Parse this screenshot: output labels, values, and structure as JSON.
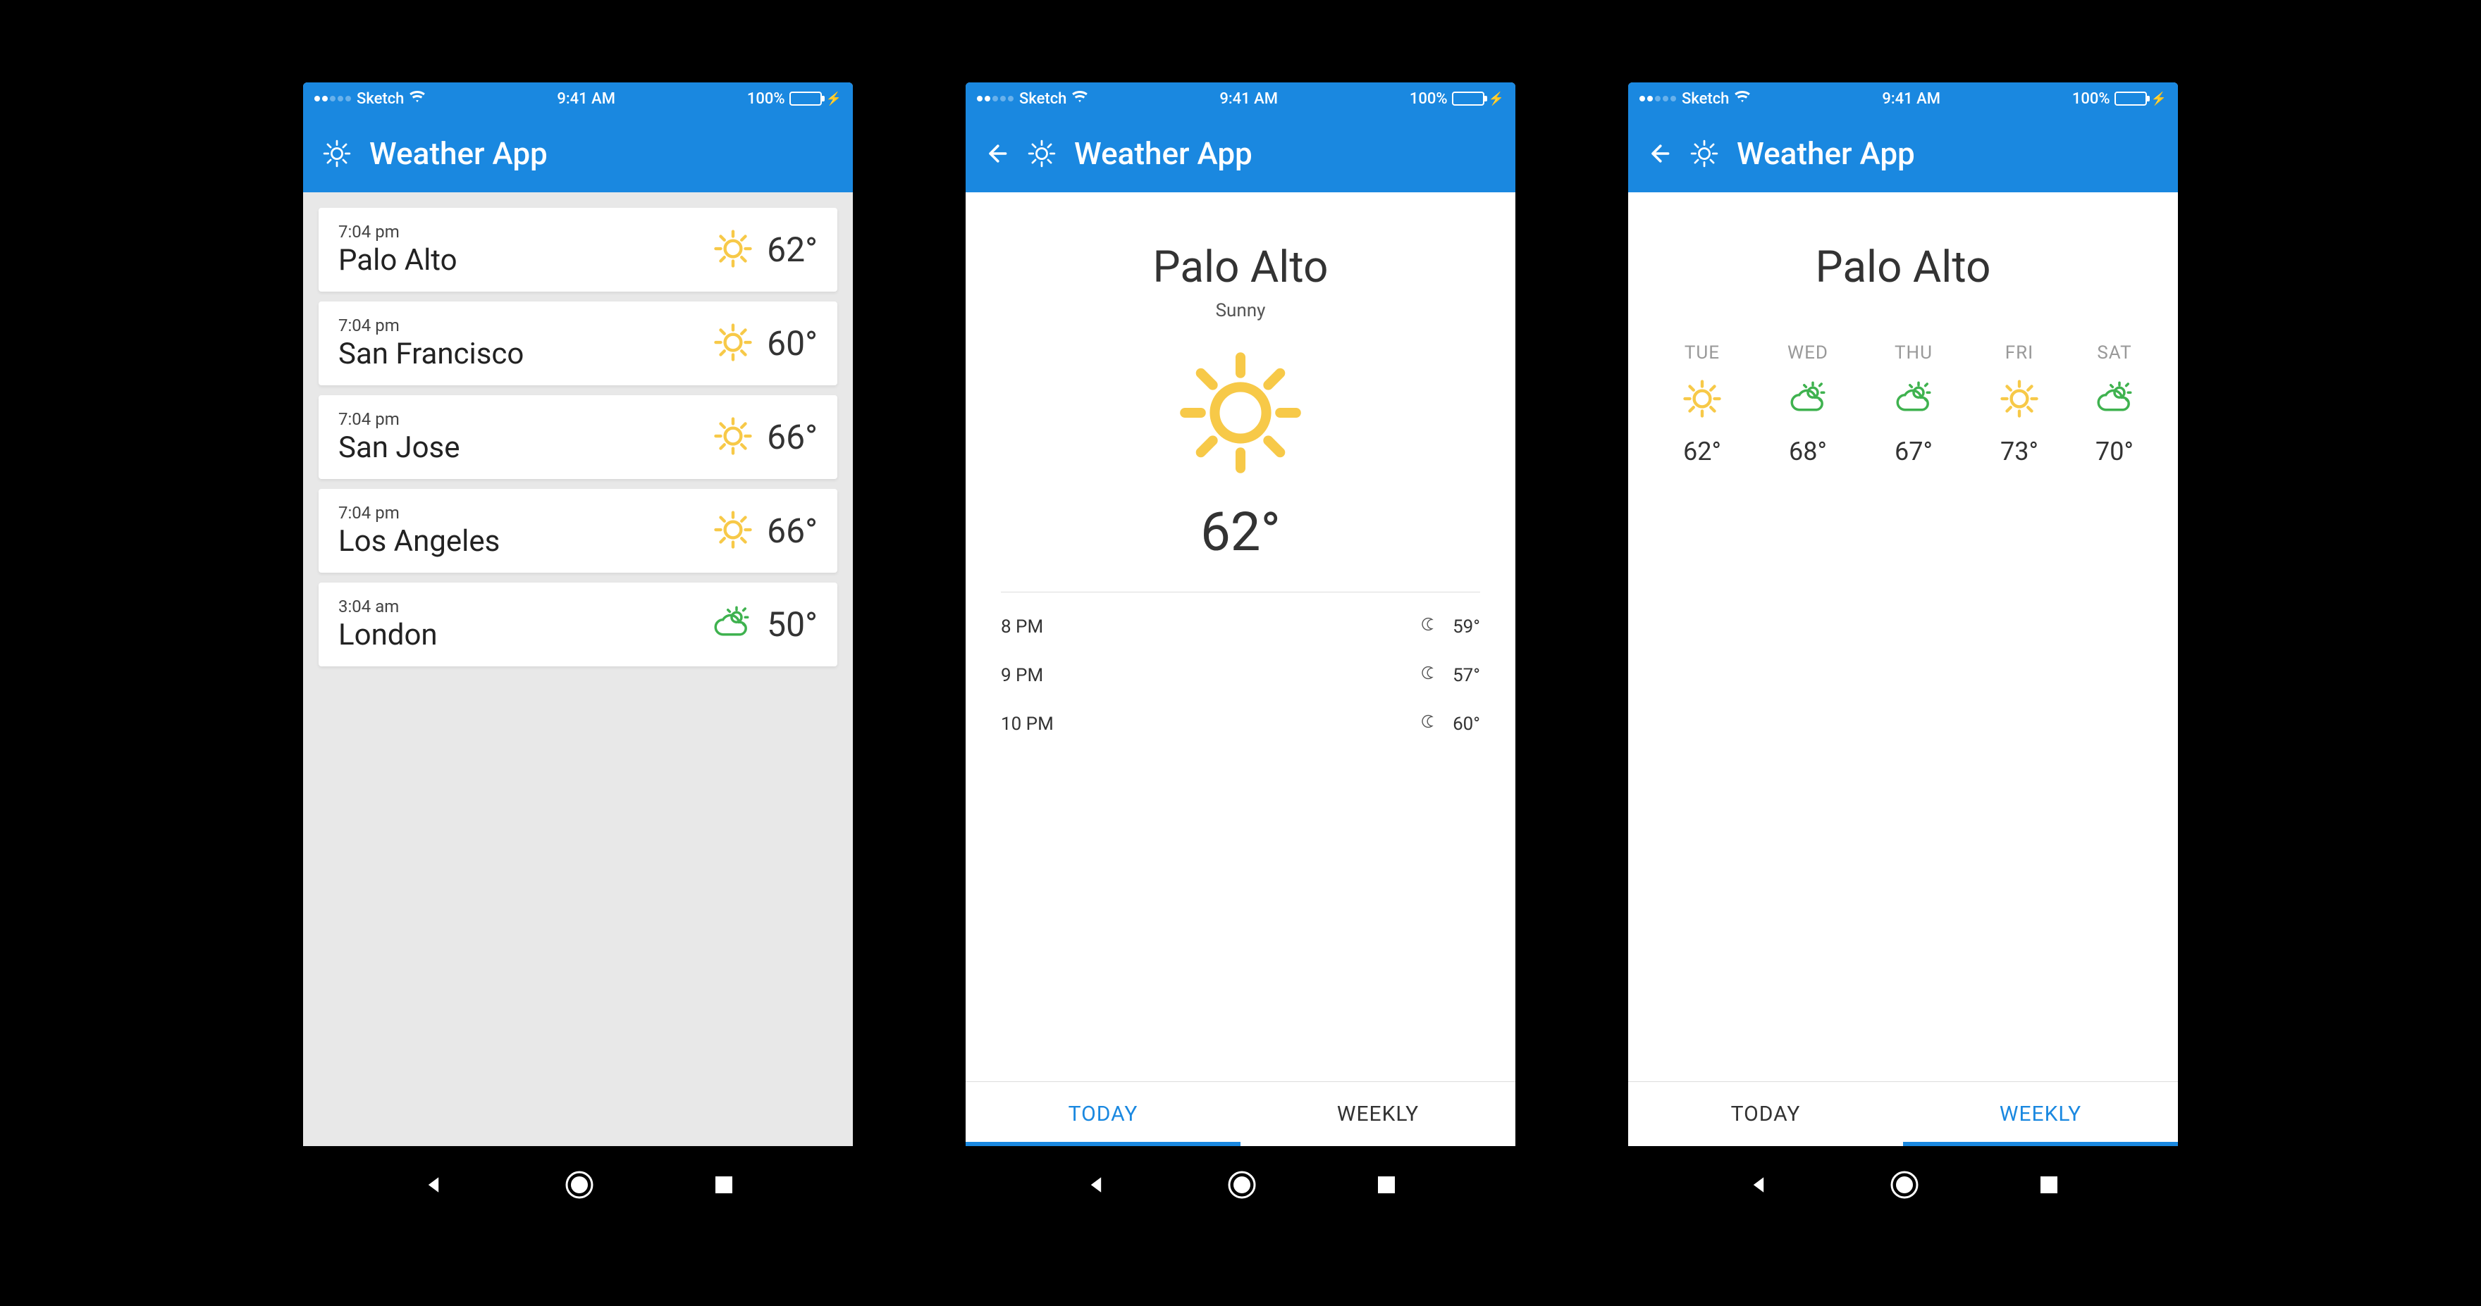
{
  "status": {
    "carrier": "Sketch",
    "time": "9:41 AM",
    "battery": "100%"
  },
  "app": {
    "title": "Weather App"
  },
  "colors": {
    "primary": "#1a88e0",
    "sun": "#f7c948",
    "cloud": "#3fb24f"
  },
  "list": {
    "cities": [
      {
        "time": "7:04 pm",
        "name": "Palo Alto",
        "icon": "sun",
        "temp": "62°"
      },
      {
        "time": "7:04 pm",
        "name": "San Francisco",
        "icon": "sun",
        "temp": "60°"
      },
      {
        "time": "7:04 pm",
        "name": "San Jose",
        "icon": "sun",
        "temp": "66°"
      },
      {
        "time": "7:04 pm",
        "name": "Los Angeles",
        "icon": "sun",
        "temp": "66°"
      },
      {
        "time": "3:04 am",
        "name": "London",
        "icon": "suncloud",
        "temp": "50°"
      }
    ]
  },
  "detail": {
    "city": "Palo Alto",
    "condition": "Sunny",
    "temp": "62°",
    "hourly": [
      {
        "hour": "8 PM",
        "icon": "moon",
        "temp": "59°"
      },
      {
        "hour": "9 PM",
        "icon": "moon",
        "temp": "57°"
      },
      {
        "hour": "10 PM",
        "icon": "moon",
        "temp": "60°"
      }
    ],
    "tabs": {
      "today": "TODAY",
      "weekly": "WEEKLY"
    }
  },
  "weekly": {
    "city": "Palo Alto",
    "days": [
      {
        "label": "TUE",
        "icon": "sun",
        "temp": "62°"
      },
      {
        "label": "WED",
        "icon": "suncloud",
        "temp": "68°"
      },
      {
        "label": "THU",
        "icon": "suncloud",
        "temp": "67°"
      },
      {
        "label": "FRI",
        "icon": "sun",
        "temp": "73°"
      },
      {
        "label": "SAT",
        "icon": "suncloud",
        "temp": "70°"
      }
    ],
    "tabs": {
      "today": "TODAY",
      "weekly": "WEEKLY"
    }
  }
}
